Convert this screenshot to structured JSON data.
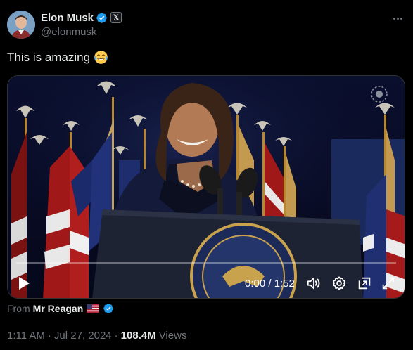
{
  "author": {
    "display_name": "Elon Musk",
    "handle": "@elonmusk",
    "verified_badge_icon": "verified-badge-icon",
    "affiliation_badge": "𝕏"
  },
  "tweet": {
    "text": "This is amazing",
    "emoji": "face-with-tears-of-joy"
  },
  "video": {
    "time_display": "0:00 / 1:52",
    "controls": [
      "play-icon",
      "volume-icon",
      "settings-icon",
      "pip-icon",
      "fullscreen-icon"
    ],
    "overlay_icon": "replay-watermark-icon",
    "progress": 0
  },
  "source": {
    "prefix": "From",
    "name": "Mr Reagan",
    "flag": "us-flag-icon"
  },
  "meta": {
    "time": "1:11 AM",
    "date": "Jul 27, 2024",
    "separator": "·",
    "views_count": "108.4M",
    "views_label": "Views"
  },
  "colors": {
    "background": "#000000",
    "primary_text": "#e7e9ea",
    "secondary_text": "#71767b",
    "verified_blue": "#1d9bf0",
    "border": "#2f3336"
  }
}
